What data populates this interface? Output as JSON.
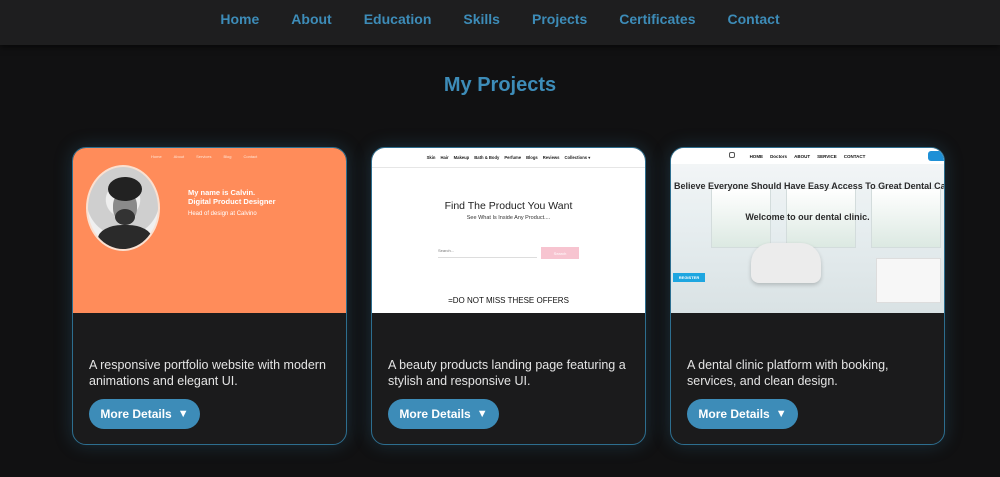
{
  "nav": {
    "items": [
      "Home",
      "About",
      "Education",
      "Skills",
      "Projects",
      "Certificates",
      "Contact"
    ]
  },
  "section": {
    "title": "My Projects"
  },
  "projects": [
    {
      "description": "A responsive portfolio website with modern animations and elegant UI.",
      "button_label": "More Details",
      "caret": "▼",
      "preview": {
        "nav": [
          "Home",
          "About",
          "Services",
          "Blog",
          "Contact"
        ],
        "intro": "My name is Calvin.\nDigital Product Designer",
        "sub": "Head of design at Calvino"
      }
    },
    {
      "description": "A beauty products landing page featuring a stylish and responsive UI.",
      "button_label": "More Details",
      "caret": "▼",
      "preview": {
        "nav": [
          "Skin",
          "Hair",
          "Makeup",
          "Bath & Body",
          "Perfume",
          "Blogs",
          "Reviews",
          "Collections ▾"
        ],
        "headline": "Find The Product You Want",
        "subhead": "See What Is Inside Any Product....",
        "search_placeholder": "Search...",
        "search_button": "Search",
        "offers": "=DO NOT MISS THESE OFFERS"
      }
    },
    {
      "description": "A dental clinic platform with booking, services, and clean design.",
      "button_label": "More Details",
      "caret": "▼",
      "preview": {
        "nav": [
          "HOME",
          "Doctors",
          "ABOUT",
          "SERVICE",
          "CONTACT"
        ],
        "banner": "Believe Everyone Should Have Easy Access To Great Dental Care",
        "welcome": "Welcome to our dental clinic.",
        "register": "REGISTER"
      }
    }
  ]
}
